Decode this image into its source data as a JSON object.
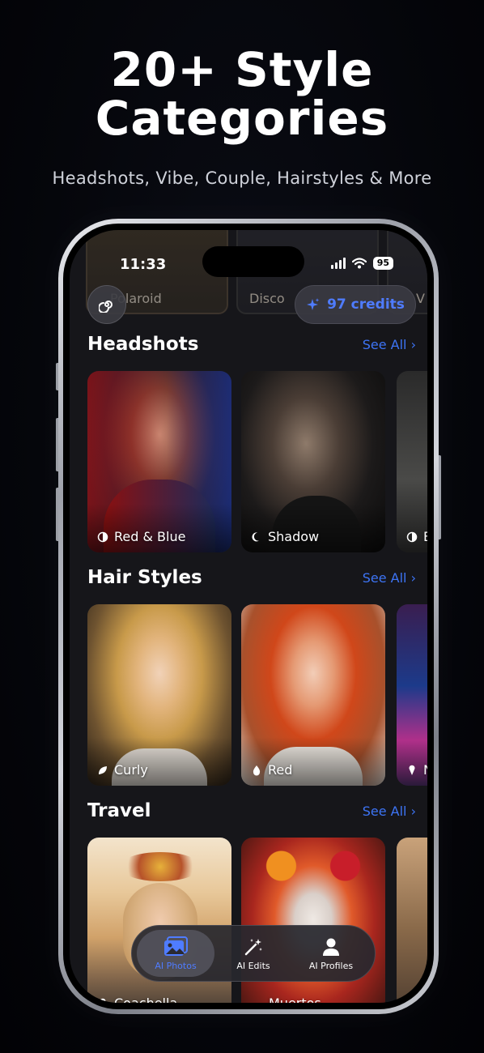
{
  "promo": {
    "headline_line1": "20+ Style",
    "headline_line2": "Categories",
    "subheadline": "Headshots, Vibe, Couple, Hairstyles & More"
  },
  "status_bar": {
    "time": "11:33",
    "battery": "95"
  },
  "top_strip": {
    "card_labels": [
      "Polaroid",
      "Disco",
      "V"
    ]
  },
  "header": {
    "credits": "97 credits",
    "logo_icon": "spiral-logo-icon",
    "credits_icon": "sparkle-icon"
  },
  "sections": [
    {
      "title": "Headshots",
      "see_all": "See All",
      "cards": [
        {
          "label": "Red & Blue",
          "icon": "half-circle-icon"
        },
        {
          "label": "Shadow",
          "icon": "moon-icon"
        },
        {
          "label": "B",
          "icon": "half-circle-icon"
        }
      ]
    },
    {
      "title": "Hair Styles",
      "see_all": "See All",
      "cards": [
        {
          "label": "Curly",
          "icon": "leaf-icon"
        },
        {
          "label": "Red",
          "icon": "drop-icon"
        },
        {
          "label": "N",
          "icon": "pin-icon"
        }
      ]
    },
    {
      "title": "Travel",
      "see_all": "See All",
      "cards": [
        {
          "label": "Coachella",
          "icon": "pin-icon"
        },
        {
          "label": "Muertos",
          "icon": "pin-icon"
        },
        {
          "label": "",
          "icon": ""
        }
      ]
    }
  ],
  "tabbar": {
    "tabs": [
      {
        "label": "AI Photos",
        "icon": "photos-icon",
        "active": true
      },
      {
        "label": "AI Edits",
        "icon": "magic-wand-icon",
        "active": false
      },
      {
        "label": "AI Profiles",
        "icon": "person-icon",
        "active": false
      }
    ]
  },
  "colors": {
    "accent": "#4f7cff",
    "background": "#16161a",
    "link": "#3d74f5"
  }
}
